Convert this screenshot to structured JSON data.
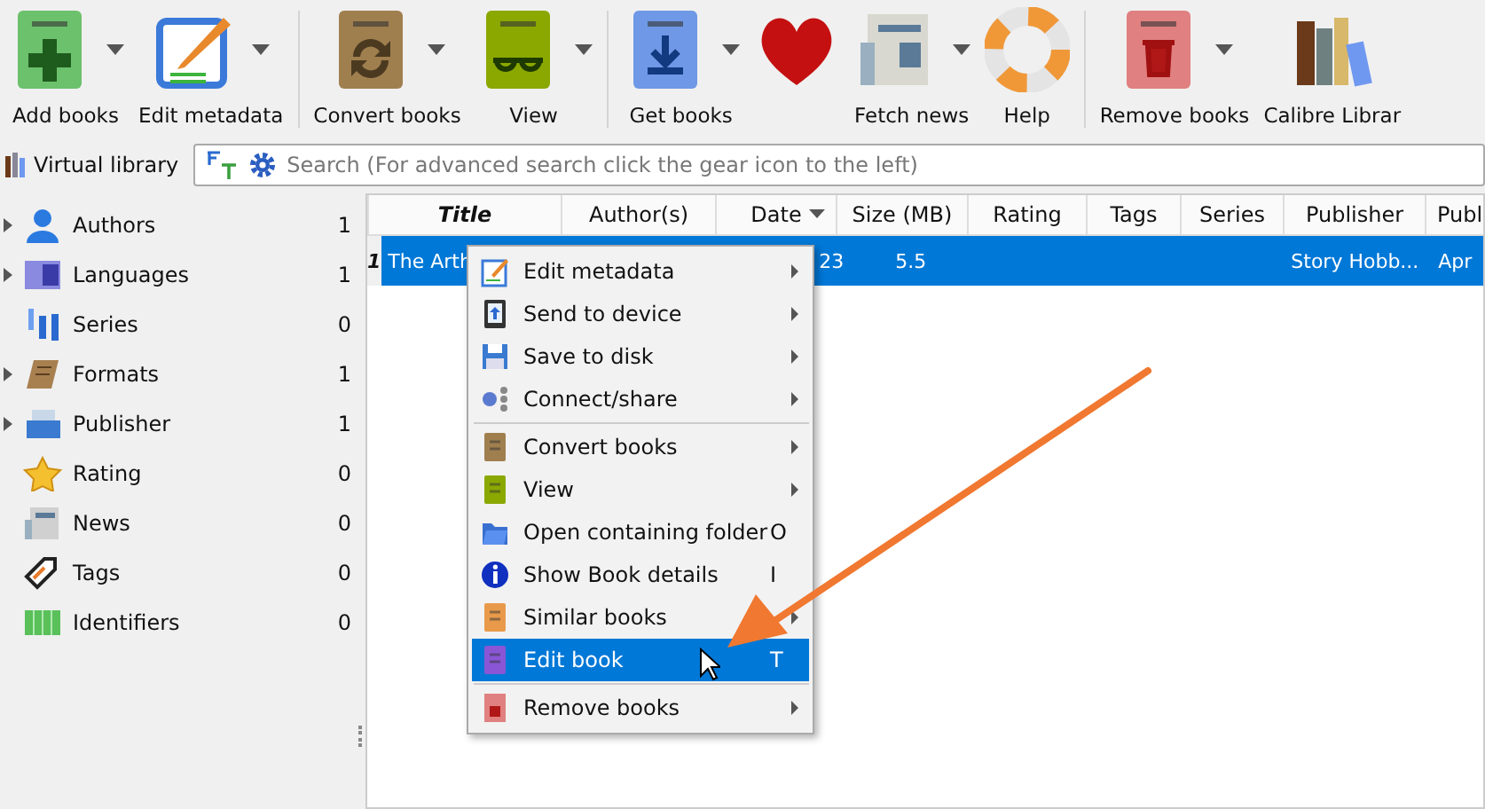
{
  "toolbar": [
    {
      "label": "Add books",
      "dropdown": true,
      "separator_after": false
    },
    {
      "label": "Edit metadata",
      "dropdown": true,
      "separator_after": true
    },
    {
      "label": "Convert books",
      "dropdown": true,
      "separator_after": false
    },
    {
      "label": "View",
      "dropdown": true,
      "separator_after": true
    },
    {
      "label": "Get books",
      "dropdown": true,
      "separator_after": false
    },
    {
      "dropdown": false,
      "separator_after": false
    },
    {
      "label": "Fetch news",
      "dropdown": true,
      "separator_after": false
    },
    {
      "label": "Help",
      "dropdown": false,
      "separator_after": true
    },
    {
      "label": "Remove books",
      "dropdown": true,
      "separator_after": false
    },
    {
      "label": "Calibre Librar",
      "dropdown": false,
      "separator_after": false
    }
  ],
  "virtual_library": "Virtual library",
  "search": {
    "placeholder": "Search (For advanced search click the gear icon to the left)"
  },
  "sidebar": {
    "items": [
      {
        "label": "Authors",
        "count": "1",
        "expandable": true
      },
      {
        "label": "Languages",
        "count": "1",
        "expandable": true
      },
      {
        "label": "Series",
        "count": "0",
        "expandable": false
      },
      {
        "label": "Formats",
        "count": "1",
        "expandable": true
      },
      {
        "label": "Publisher",
        "count": "1",
        "expandable": true
      },
      {
        "label": "Rating",
        "count": "0",
        "expandable": false
      },
      {
        "label": "News",
        "count": "0",
        "expandable": false
      },
      {
        "label": "Tags",
        "count": "0",
        "expandable": false
      },
      {
        "label": "Identifiers",
        "count": "0",
        "expandable": false
      }
    ]
  },
  "table": {
    "columns": [
      {
        "label": "Title",
        "sorted": false
      },
      {
        "label": "Author(s)",
        "sorted": false
      },
      {
        "label": "Date",
        "sorted": true
      },
      {
        "label": "Size (MB)",
        "sorted": false
      },
      {
        "label": "Rating",
        "sorted": false
      },
      {
        "label": "Tags",
        "sorted": false
      },
      {
        "label": "Series",
        "sorted": false
      },
      {
        "label": "Publisher",
        "sorted": false
      },
      {
        "label": "Publ",
        "sorted": false
      }
    ],
    "rows": [
      {
        "number": "1",
        "selected": true,
        "cells": [
          "The Arth",
          null,
          "23",
          "5.5",
          null,
          null,
          null,
          "Story Hobb...",
          "Apr"
        ]
      }
    ]
  },
  "context_menu": {
    "items": [
      {
        "label": "Edit metadata",
        "submenu": true,
        "selected": false,
        "separator_after": false
      },
      {
        "label": "Send to device",
        "submenu": true,
        "selected": false,
        "separator_after": false
      },
      {
        "label": "Save to disk",
        "submenu": true,
        "selected": false,
        "separator_after": false
      },
      {
        "label": "Connect/share",
        "submenu": true,
        "selected": false,
        "separator_after": true
      },
      {
        "label": "Convert books",
        "submenu": true,
        "selected": false,
        "separator_after": false
      },
      {
        "label": "View",
        "submenu": true,
        "selected": false,
        "separator_after": false
      },
      {
        "label": "Open containing folder",
        "submenu": false,
        "shortcut": "O",
        "selected": false,
        "separator_after": false
      },
      {
        "label": "Show Book details",
        "submenu": false,
        "shortcut": "I",
        "selected": false,
        "separator_after": false
      },
      {
        "label": "Similar books",
        "submenu": true,
        "selected": false,
        "separator_after": false
      },
      {
        "label": "Edit book",
        "submenu": false,
        "shortcut": "T",
        "selected": true,
        "separator_after": true
      },
      {
        "label": "Remove books",
        "submenu": true,
        "selected": false,
        "separator_after": false
      }
    ]
  }
}
